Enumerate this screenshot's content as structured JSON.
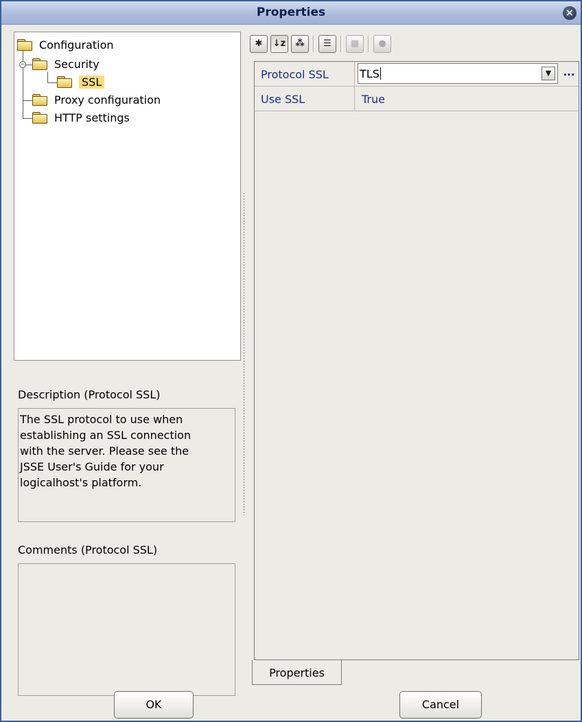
{
  "window": {
    "title": "Properties"
  },
  "tree": {
    "root": "Configuration",
    "items": [
      {
        "label": "Security"
      },
      {
        "label": "SSL",
        "selected": true
      },
      {
        "label": "Proxy configuration"
      },
      {
        "label": "HTTP settings"
      }
    ]
  },
  "description": {
    "label": "Description (Protocol SSL)",
    "lines": [
      "The SSL protocol to use when",
      "establishing an SSL connection",
      "with the server. Please see the",
      "JSSE User's Guide for your",
      "logicalhost's platform."
    ]
  },
  "comments": {
    "label": "Comments (Protocol SSL)",
    "value": ""
  },
  "toolbar": {
    "icons": [
      "collapse-icon",
      "sort-alpha-icon",
      "categorized-icon",
      "checklist-icon",
      "grid-icon",
      "help-icon"
    ]
  },
  "properties": [
    {
      "name": "Protocol SSL",
      "value": "TLS",
      "editing": true
    },
    {
      "name": "Use SSL",
      "value": "True"
    }
  ],
  "tab": {
    "label": "Properties"
  },
  "buttons": {
    "ok": "OK",
    "cancel": "Cancel"
  },
  "colors": {
    "title_text": "#0d1f4d",
    "property_text": "#1c2f8c",
    "selection": "#fddc7a"
  }
}
